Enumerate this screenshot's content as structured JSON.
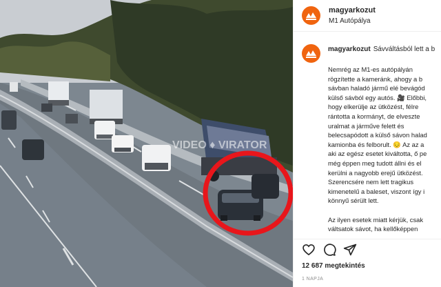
{
  "header": {
    "username": "magyarkozut",
    "location": "M1 Autópálya"
  },
  "caption": {
    "username": "magyarkozut",
    "first_line": "Sávváltásból lett a b",
    "lines": [
      "Nemrég az M1-es autópályán",
      "rögzítette a kameránk, ahogy a b",
      "sávban haladó jármű elé bevágód",
      "külső sávból egy autós. 🎥 Előbbi,",
      "hogy elkerülje az ütközést, félre",
      "rántotta a kormányt, de elveszte",
      "uralmat a járműve felett és",
      "belecsapódott a külső sávon halad",
      "kamionba és felborult. 😔 Az az a",
      "aki az egész esetet kiváltotta, ő pe",
      "még éppen meg tudott állni és el",
      "kerülni a nagyobb erejű ütközést.",
      "Szerencsére nem lett tragikus",
      "kimenetelű a baleset, viszont így i",
      "könnyű sérült lett.",
      "",
      "Az ilyen esetek miatt kérjük, csak",
      "váltsatok sávot, ha kellőképpen"
    ]
  },
  "stats": {
    "views": "12 687 megtekintés",
    "time_ago": "1 NAPJA"
  },
  "media": {
    "watermark": "VIDEO ♦ VIRATOR"
  },
  "colors": {
    "brand": "#f0640f",
    "highlight_circle": "#e8161b"
  },
  "icons": [
    "heart-icon",
    "comment-icon",
    "share-icon"
  ]
}
